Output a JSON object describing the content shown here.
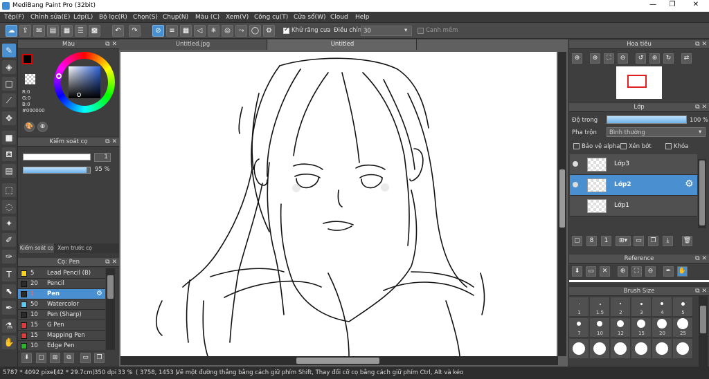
{
  "window": {
    "title": "MediBang Paint Pro (32bit)",
    "min": "—",
    "max": "❐",
    "close": "✕"
  },
  "menu": [
    "Tệp(F)",
    "Chỉnh sửa(E)",
    "Lớp(L)",
    "Bộ lọc(R)",
    "Chọn(S)",
    "Chụp(N)",
    "Màu (C)",
    "Xem(V)",
    "Công cụ(T)",
    "Cửa sổ(W)",
    "Cloud",
    "Help"
  ],
  "toolbar": {
    "antialias_label": "Khử răng cưa",
    "correction_label": "Điều chỉnh",
    "correction_value": "30",
    "snap_label": "Canh mềm"
  },
  "color_panel": {
    "title": "Màu",
    "r": "R:0",
    "g": "G:0",
    "b": "B:0",
    "hex": "#000000",
    "primary": "#000000"
  },
  "brush_control": {
    "title": "Kiểm soát cọ",
    "size_value": "1",
    "opacity_value": "95 %",
    "opacity": 0.95,
    "tab1": "Kiểm soát cọ",
    "tab2": "Xem trước cọ"
  },
  "brush_list": {
    "title": "Cọ: Pen",
    "items": [
      {
        "size": "5",
        "name": "Lead Pencil (B)",
        "color": "#f7d11a"
      },
      {
        "size": "20",
        "name": "Pencil",
        "color": "#2b2b2b"
      },
      {
        "size": "1",
        "name": "Pen",
        "color": "#2b2b2b"
      },
      {
        "size": "50",
        "name": "Watercolor",
        "color": "#5ec8f5"
      },
      {
        "size": "10",
        "name": "Pen (Sharp)",
        "color": "#2b2b2b"
      },
      {
        "size": "15",
        "name": "G Pen",
        "color": "#e23a3a"
      },
      {
        "size": "15",
        "name": "Mapping Pen",
        "color": "#e23a3a"
      },
      {
        "size": "10",
        "name": "Edge Pen",
        "color": "#2ab52a"
      }
    ]
  },
  "canvas_tabs": [
    "Untitled.jpg",
    "Untitled"
  ],
  "navigator": {
    "title": "Hoa tiêu"
  },
  "layer_panel": {
    "title": "Lớp",
    "opacity_label": "Độ trong",
    "opacity_value": "100 %",
    "opacity": 1.0,
    "blend_label": "Pha trộn",
    "blend_value": "Bình thường",
    "protect_alpha": "Bảo vệ alpha",
    "clip": "Xén bớt",
    "lock": "Khóa",
    "layers": [
      "Lớp3",
      "Lớp2",
      "Lớp1"
    ]
  },
  "reference": {
    "title": "Reference"
  },
  "brush_size": {
    "title": "Brush Size",
    "sizes": [
      "1",
      "1.5",
      "2",
      "3",
      "4",
      "5",
      "7",
      "10",
      "12",
      "15",
      "20",
      "25"
    ]
  },
  "status": {
    "pixels": "5787 * 4092 pixel",
    "cm": "(42 * 29.7cm)",
    "dpi": "350 dpi",
    "zoom": "33 %",
    "coords": "( 3758, 1453 )",
    "hint": "Vẽ một đường thẳng bằng cách giữ phím Shift, Thay đổi cỡ cọ bằng cách giữ phím Ctrl, Alt và kéo"
  }
}
